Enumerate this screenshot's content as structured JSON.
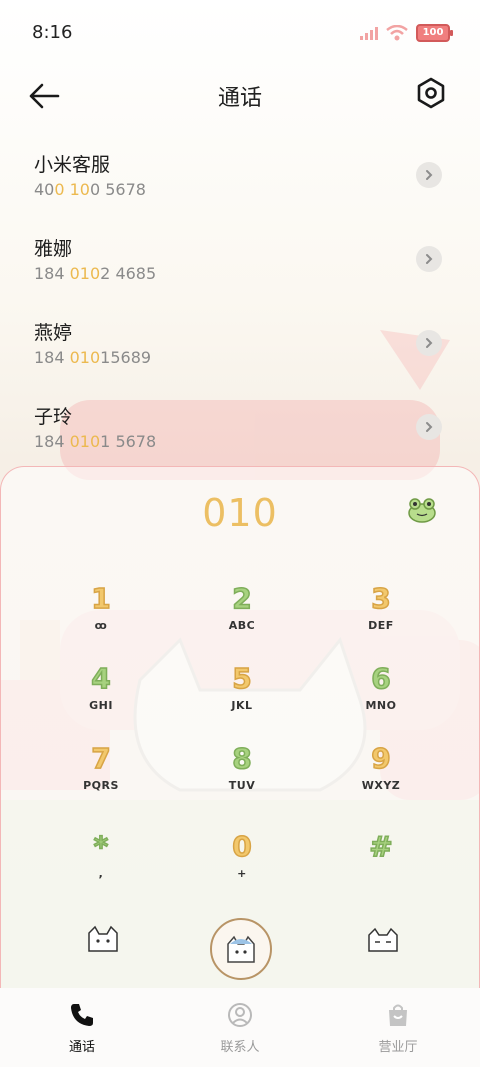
{
  "status_bar": {
    "time": "8:16",
    "battery": "100"
  },
  "header": {
    "title": "通话"
  },
  "results": [
    {
      "name": "小米客服",
      "number_parts": [
        [
          "40",
          false
        ],
        [
          "0 10",
          true
        ],
        [
          "0 5678",
          false
        ]
      ]
    },
    {
      "name": "雅娜",
      "number_parts": [
        [
          "184 ",
          false
        ],
        [
          "010",
          true
        ],
        [
          "2 4685",
          false
        ]
      ]
    },
    {
      "name": "燕婷",
      "number_parts": [
        [
          "184 ",
          false
        ],
        [
          "010",
          true
        ],
        [
          "15689",
          false
        ]
      ]
    },
    {
      "name": "子玲",
      "number_parts": [
        [
          "184 ",
          false
        ],
        [
          "010",
          true
        ],
        [
          "1 5678",
          false
        ]
      ]
    }
  ],
  "dialpad": {
    "input": "010",
    "keys": [
      {
        "digit": "1",
        "sub": "ꝏ",
        "name": "key-1"
      },
      {
        "digit": "2",
        "sub": "ABC",
        "name": "key-2"
      },
      {
        "digit": "3",
        "sub": "DEF",
        "name": "key-3"
      },
      {
        "digit": "4",
        "sub": "GHI",
        "name": "key-4"
      },
      {
        "digit": "5",
        "sub": "JKL",
        "name": "key-5"
      },
      {
        "digit": "6",
        "sub": "MNO",
        "name": "key-6"
      },
      {
        "digit": "7",
        "sub": "PQRS",
        "name": "key-7"
      },
      {
        "digit": "8",
        "sub": "TUV",
        "name": "key-8"
      },
      {
        "digit": "9",
        "sub": "WXYZ",
        "name": "key-9"
      },
      {
        "digit": "*",
        "sub": ",",
        "name": "key-star"
      },
      {
        "digit": "0",
        "sub": "+",
        "name": "key-0"
      },
      {
        "digit": "#",
        "sub": "",
        "name": "key-hash"
      }
    ]
  },
  "bottom_nav": [
    {
      "label": "通话",
      "icon": "phone-icon",
      "active": true
    },
    {
      "label": "联系人",
      "icon": "contact-icon",
      "active": false
    },
    {
      "label": "营业厅",
      "icon": "shopping-bag-icon",
      "active": false
    }
  ],
  "colors": {
    "highlight": "#ecb94f",
    "accent_border": "#f3b7b7"
  }
}
